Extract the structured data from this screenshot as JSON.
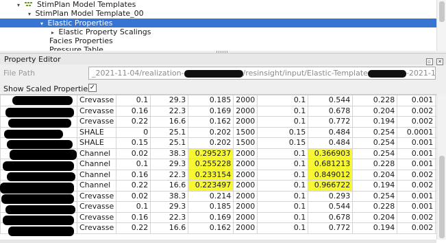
{
  "tree": {
    "items": [
      {
        "label": "StimPlan Model Templates",
        "arrow": "▾",
        "indent": 0,
        "selected": false
      },
      {
        "label": "StimPlan Model Template_00",
        "arrow": "▾",
        "indent": 1,
        "selected": false
      },
      {
        "label": "Elastic Properties",
        "arrow": "▾",
        "indent": 2,
        "selected": true
      },
      {
        "label": "Elastic Property Scalings",
        "arrow": "▸",
        "indent": 3,
        "selected": false
      },
      {
        "label": "Facies Properties",
        "arrow": "",
        "indent": 2,
        "selected": false
      },
      {
        "label": "Pressure Table",
        "arrow": "",
        "indent": 2,
        "selected": false
      }
    ]
  },
  "property_editor": {
    "title": "Property Editor",
    "restore_icon": "▫",
    "close_icon": "✕",
    "file_path_label": "File Path",
    "file_path_part1": "_2021-11-04/realization-",
    "file_path_part2": "/resinsight/input/Elastic-Template",
    "file_path_part3": "-2021-11-18.csv",
    "show_scaled_label": "Show Scaled Properties",
    "show_scaled_checked": "✓"
  },
  "table": {
    "rows": [
      {
        "facies": "Crevasse",
        "c1": "0.1",
        "c2": "29.3",
        "c3": "0.185",
        "c4": "2000",
        "c5": "0.1",
        "c6": "0.544",
        "c7": "0.228",
        "c8": "0.001",
        "h3": false,
        "h6": false
      },
      {
        "facies": "Crevasse",
        "c1": "0.16",
        "c2": "22.3",
        "c3": "0.169",
        "c4": "2000",
        "c5": "0.1",
        "c6": "0.678",
        "c7": "0.204",
        "c8": "0.002",
        "h3": false,
        "h6": false
      },
      {
        "facies": "Crevasse",
        "c1": "0.22",
        "c2": "16.6",
        "c3": "0.162",
        "c4": "2000",
        "c5": "0.1",
        "c6": "0.772",
        "c7": "0.194",
        "c8": "0.002",
        "h3": false,
        "h6": false
      },
      {
        "facies": "SHALE",
        "c1": "0",
        "c2": "25.1",
        "c3": "0.202",
        "c4": "1500",
        "c5": "0.15",
        "c6": "0.484",
        "c7": "0.254",
        "c8": "0.0001",
        "h3": false,
        "h6": false
      },
      {
        "facies": "SHALE",
        "c1": "0.15",
        "c2": "25.1",
        "c3": "0.202",
        "c4": "1500",
        "c5": "0.15",
        "c6": "0.484",
        "c7": "0.254",
        "c8": "0.001",
        "h3": false,
        "h6": false
      },
      {
        "facies": "Channel",
        "c1": "0.02",
        "c2": "38.3",
        "c3": "0.295237",
        "c4": "2000",
        "c5": "0.1",
        "c6": "0.366903",
        "c7": "0.254",
        "c8": "0.001",
        "h3": true,
        "h6": true
      },
      {
        "facies": "Channel",
        "c1": "0.1",
        "c2": "29.3",
        "c3": "0.255228",
        "c4": "2000",
        "c5": "0.1",
        "c6": "0.681213",
        "c7": "0.228",
        "c8": "0.001",
        "h3": true,
        "h6": true
      },
      {
        "facies": "Channel",
        "c1": "0.16",
        "c2": "22.3",
        "c3": "0.233154",
        "c4": "2000",
        "c5": "0.1",
        "c6": "0.849012",
        "c7": "0.204",
        "c8": "0.002",
        "h3": true,
        "h6": true
      },
      {
        "facies": "Channel",
        "c1": "0.22",
        "c2": "16.6",
        "c3": "0.223497",
        "c4": "2000",
        "c5": "0.1",
        "c6": "0.966722",
        "c7": "0.194",
        "c8": "0.002",
        "h3": true,
        "h6": true
      },
      {
        "facies": "Crevasse",
        "c1": "0.02",
        "c2": "38.3",
        "c3": "0.214",
        "c4": "2000",
        "c5": "0.1",
        "c6": "0.293",
        "c7": "0.254",
        "c8": "0.001",
        "h3": false,
        "h6": false
      },
      {
        "facies": "Crevasse",
        "c1": "0.1",
        "c2": "29.3",
        "c3": "0.185",
        "c4": "2000",
        "c5": "0.1",
        "c6": "0.544",
        "c7": "0.228",
        "c8": "0.001",
        "h3": false,
        "h6": false
      },
      {
        "facies": "Crevasse",
        "c1": "0.16",
        "c2": "22.3",
        "c3": "0.169",
        "c4": "2000",
        "c5": "0.1",
        "c6": "0.678",
        "c7": "0.204",
        "c8": "0.002",
        "h3": false,
        "h6": false
      },
      {
        "facies": "Crevasse",
        "c1": "0.22",
        "c2": "16.6",
        "c3": "0.162",
        "c4": "2000",
        "c5": "0.1",
        "c6": "0.772",
        "c7": "0.194",
        "c8": "0.002",
        "h3": false,
        "h6": false
      }
    ]
  },
  "colors": {
    "selection": "#3874d1",
    "highlight": "#f7f733"
  }
}
